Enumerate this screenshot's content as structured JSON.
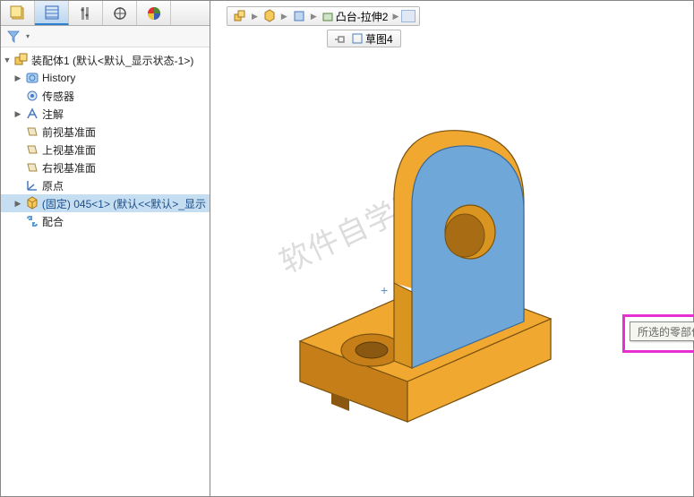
{
  "tabs": {
    "count": 5
  },
  "tree": {
    "root": "装配体1 (默认<默认_显示状态-1>)",
    "items": [
      {
        "label": "History"
      },
      {
        "label": "传感器"
      },
      {
        "label": "注解"
      },
      {
        "label": "前视基准面"
      },
      {
        "label": "上视基准面"
      },
      {
        "label": "右视基准面"
      },
      {
        "label": "原点"
      },
      {
        "label": "(固定) 045<1> (默认<<默认>_显示",
        "selected": true
      },
      {
        "label": "配合"
      }
    ]
  },
  "breadcrumb": {
    "main": "凸台-拉伸2",
    "sub": "草图4"
  },
  "viewport": {
    "tooltip": "所选的零部件为固定的，无法被移动。",
    "watermark": "软件自学网"
  }
}
